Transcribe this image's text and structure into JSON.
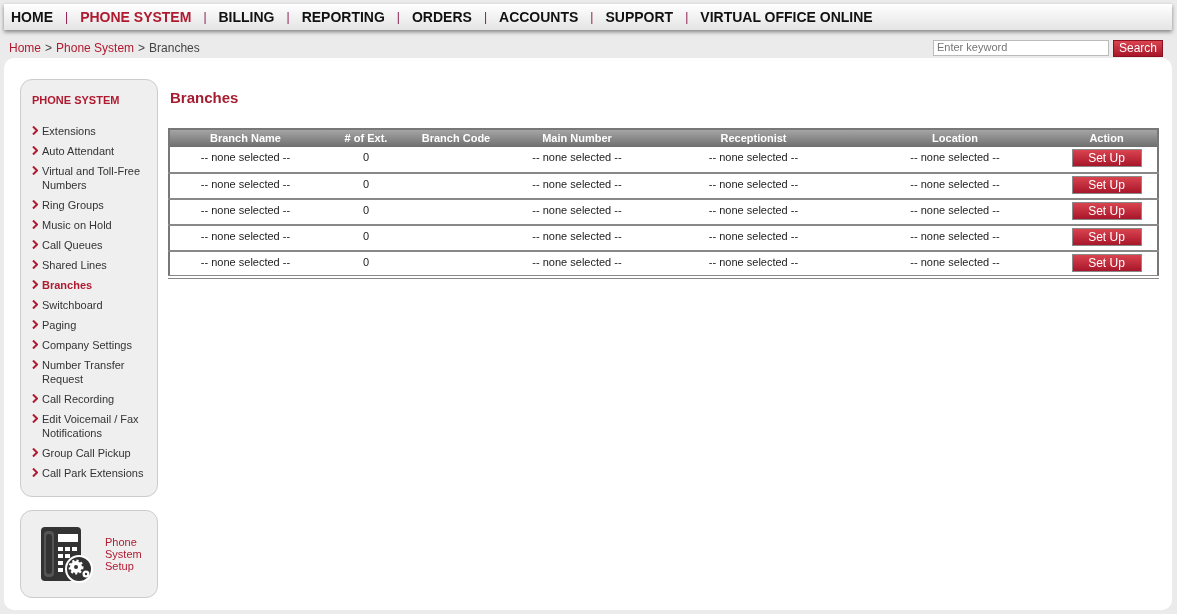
{
  "nav": [
    {
      "label": "HOME",
      "selected": false
    },
    {
      "label": "PHONE SYSTEM",
      "selected": true
    },
    {
      "label": "BILLING",
      "selected": false
    },
    {
      "label": "REPORTING",
      "selected": false
    },
    {
      "label": "ORDERS",
      "selected": false
    },
    {
      "label": "ACCOUNTS",
      "selected": false
    },
    {
      "label": "SUPPORT",
      "selected": false
    },
    {
      "label": "VIRTUAL OFFICE ONLINE",
      "selected": false
    }
  ],
  "nav_separator": "|",
  "breadcrumb": {
    "links": [
      "Home",
      "Phone System"
    ],
    "separator": ">",
    "current": "Branches"
  },
  "search": {
    "placeholder": "Enter keyword",
    "button": "Search"
  },
  "sidebar": {
    "title": "PHONE SYSTEM",
    "items": [
      {
        "label": "Extensions",
        "selected": false
      },
      {
        "label": "Auto Attendant",
        "selected": false
      },
      {
        "label": "Virtual and Toll-Free Numbers",
        "selected": false
      },
      {
        "label": "Ring Groups",
        "selected": false
      },
      {
        "label": "Music on Hold",
        "selected": false
      },
      {
        "label": "Call Queues",
        "selected": false
      },
      {
        "label": "Shared Lines",
        "selected": false
      },
      {
        "label": "Branches",
        "selected": true
      },
      {
        "label": "Switchboard",
        "selected": false
      },
      {
        "label": "Paging",
        "selected": false
      },
      {
        "label": "Company Settings",
        "selected": false
      },
      {
        "label": "Number Transfer Request",
        "selected": false
      },
      {
        "label": "Call Recording",
        "selected": false
      },
      {
        "label": "Edit Voicemail / Fax Notifications",
        "selected": false
      },
      {
        "label": "Group Call Pickup",
        "selected": false
      },
      {
        "label": "Call Park Extensions",
        "selected": false
      }
    ]
  },
  "setup_card": {
    "label": "Phone System Setup"
  },
  "page_title": "Branches",
  "table": {
    "columns": [
      "Branch Name",
      "# of Ext.",
      "Branch Code",
      "Main Number",
      "Receptionist",
      "Location",
      "Action"
    ],
    "rows": [
      {
        "cells": [
          "-- none selected --",
          "0",
          "",
          "-- none selected --",
          "-- none selected --",
          "-- none selected --"
        ],
        "action": "Set Up"
      },
      {
        "cells": [
          "-- none selected --",
          "0",
          "",
          "-- none selected --",
          "-- none selected --",
          "-- none selected --"
        ],
        "action": "Set Up"
      },
      {
        "cells": [
          "-- none selected --",
          "0",
          "",
          "-- none selected --",
          "-- none selected --",
          "-- none selected --"
        ],
        "action": "Set Up"
      },
      {
        "cells": [
          "-- none selected --",
          "0",
          "",
          "-- none selected --",
          "-- none selected --",
          "-- none selected --"
        ],
        "action": "Set Up"
      },
      {
        "cells": [
          "-- none selected --",
          "0",
          "",
          "-- none selected --",
          "-- none selected --",
          "-- none selected --"
        ],
        "action": "Set Up"
      }
    ]
  }
}
